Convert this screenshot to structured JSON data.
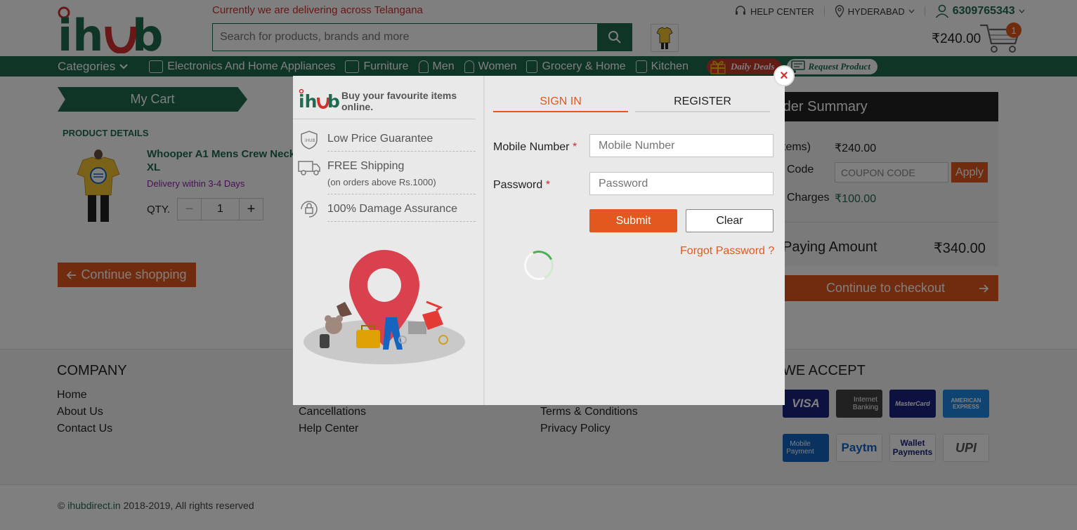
{
  "header": {
    "delivery_note": "Currently we are delivering across Telangana",
    "search_placeholder": "Search for products, brands and more",
    "help_center": "HELP CENTER",
    "city": "HYDERABAD",
    "phone": "6309765343",
    "cart_amount": "₹240.00",
    "cart_count": "1"
  },
  "nav": {
    "categories": "Categories",
    "items": [
      "Electronics And Home Appliances",
      "Furniture",
      "Men",
      "Women",
      "Grocery & Home",
      "Kitchen"
    ],
    "daily_deals": "Daily Deals",
    "request_product": "Request Product"
  },
  "cart": {
    "tab": "My Cart",
    "product_details_heading": "PRODUCT DETAILS",
    "product": {
      "name": "Whooper A1 Mens Crew Neck XL",
      "delivery": "Delivery within 3-4 Days",
      "qty_label": "QTY.",
      "qty": "1"
    },
    "continue_shopping": "Continue shopping"
  },
  "order_summary": {
    "title": "rder Summary",
    "items_label": "tems)",
    "items_value": "₹240.00",
    "code_label": "Code",
    "coupon_placeholder": "COUPON CODE",
    "apply": "Apply",
    "charges_label": "Charges",
    "charges_value": "₹100.00",
    "paying_label": "Paying Amount",
    "paying_value": "₹340.00",
    "checkout": "Continue to checkout"
  },
  "footer": {
    "company_heading": "COMPANY",
    "company_links": [
      "Home",
      "About Us",
      "Contact Us"
    ],
    "col2_links": [
      "Cancellations",
      "Help Center"
    ],
    "col3_links": [
      "Terms & Conditions",
      "Privacy Policy"
    ],
    "we_accept_heading": "WE ACCEPT",
    "payments": [
      "VISA",
      "Internet Banking",
      "MasterCard",
      "AMERICAN EXPRESS",
      "Mobile Payment",
      "Paytm",
      "Wallet Payments",
      "UPI"
    ],
    "copyright_prefix": "©",
    "copyright_site": "ihubdirect.in",
    "copyright_suffix": "2018-2019, All rights reserved"
  },
  "modal": {
    "tagline": "Buy your favourite items online.",
    "features": [
      {
        "title": "Low Price Guarantee",
        "sub": ""
      },
      {
        "title": "FREE Shipping",
        "sub": "(on orders above Rs.1000)"
      },
      {
        "title": "100% Damage Assurance",
        "sub": ""
      }
    ],
    "tab_signin": "SIGN IN",
    "tab_register": "REGISTER",
    "mobile_label": "Mobile Number",
    "mobile_placeholder": "Mobile Number",
    "password_label": "Password",
    "password_placeholder": "Password",
    "required_mark": "*",
    "submit": "Submit",
    "clear": "Clear",
    "forgot": "Forgot Password ?",
    "close": "×"
  },
  "colors": {
    "brand_green": "#1e6b4f",
    "accent_orange": "#e2581f",
    "alert_red": "#d32f2f"
  }
}
